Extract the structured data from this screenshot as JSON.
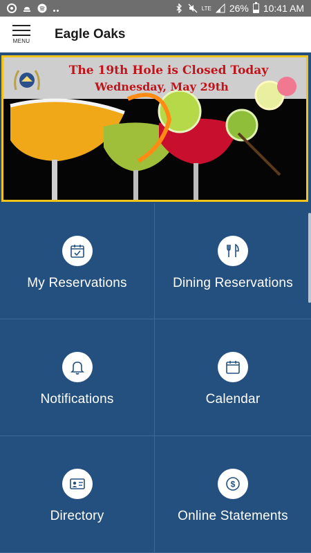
{
  "status_bar": {
    "battery_percent": "26%",
    "time": "10:41 AM",
    "network_label": "LTE",
    "icons": [
      "chrome-icon",
      "upload-icon",
      "spotify-icon",
      "bluetooth-icon",
      "mute-icon",
      "signal-icon",
      "battery-icon"
    ]
  },
  "app_bar": {
    "menu_label": "MENU",
    "title": "Eagle Oaks"
  },
  "banner": {
    "line1": "The 19th Hole is Closed Today",
    "line2": "Wednesday, May 29th",
    "border_color": "#f0c419",
    "text_color": "#c0141b"
  },
  "tiles": [
    {
      "label": "My Reservations",
      "icon": "calendar-check-icon"
    },
    {
      "label": "Dining Reservations",
      "icon": "fork-knife-icon"
    },
    {
      "label": "Notifications",
      "icon": "bell-icon"
    },
    {
      "label": "Calendar",
      "icon": "calendar-icon"
    },
    {
      "label": "Directory",
      "icon": "id-card-icon"
    },
    {
      "label": "Online Statements",
      "icon": "dollar-icon"
    }
  ],
  "colors": {
    "tile_background": "#24507f",
    "app_bar": "#ffffff",
    "status_bar": "#6e6e6e"
  }
}
